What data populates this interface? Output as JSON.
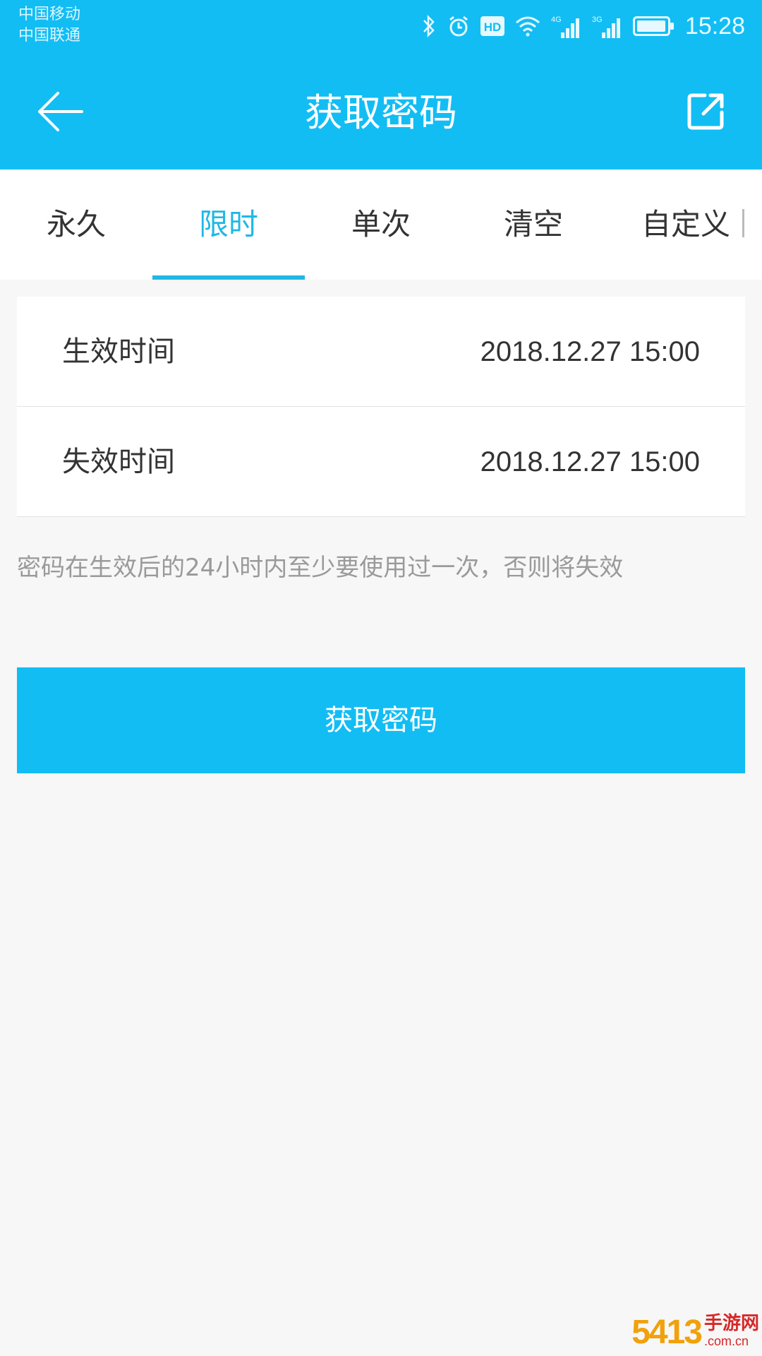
{
  "status_bar": {
    "carrier_1": "中国移动",
    "carrier_2": "中国联通",
    "time": "15:28",
    "icons": [
      "bluetooth-icon",
      "alarm-icon",
      "hd-icon",
      "wifi-icon",
      "signal-4g-icon",
      "signal-3g-icon",
      "battery-icon"
    ],
    "network_1": "4G",
    "network_2": "3G",
    "hd_label": "HD"
  },
  "header": {
    "title": "获取密码",
    "back_icon": "arrow-left-icon",
    "share_icon": "external-link-icon",
    "color": "#12bdf4"
  },
  "tabs": {
    "items": [
      {
        "label": "永久"
      },
      {
        "label": "限时"
      },
      {
        "label": "单次"
      },
      {
        "label": "清空"
      },
      {
        "label": "自定义"
      }
    ],
    "active_index": 1,
    "active_color": "#1fb8e6"
  },
  "time_card": {
    "rows": [
      {
        "label": "生效时间",
        "value": "2018.12.27 15:00"
      },
      {
        "label": "失效时间",
        "value": "2018.12.27 15:00"
      }
    ]
  },
  "hint": "密码在生效后的24小时内至少要使用过一次，否则将失效",
  "primary_button": {
    "label": "获取密码"
  },
  "watermark": {
    "brand": "5413",
    "top": "手游网",
    "bottom": ".com.cn"
  }
}
